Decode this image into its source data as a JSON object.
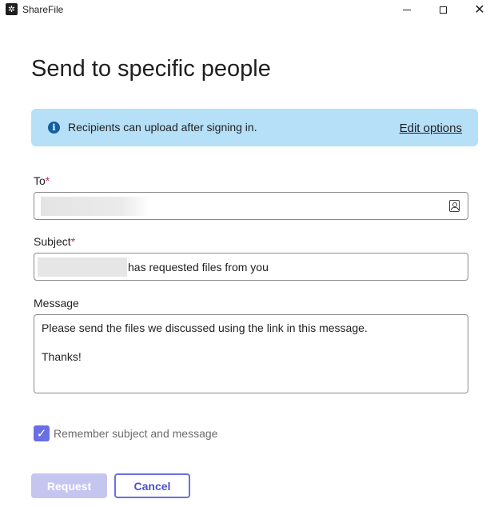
{
  "window": {
    "title": "ShareFile",
    "app_icon": "sharefile-logo-icon",
    "controls": [
      "minimize-icon",
      "maximize-icon",
      "close-icon"
    ]
  },
  "page": {
    "title": "Send to specific people"
  },
  "banner": {
    "icon": "info-icon",
    "text": "Recipients can upload after signing in.",
    "link": "Edit options",
    "color": "#b6dff8"
  },
  "form": {
    "to": {
      "label": "To",
      "required_mark": "*",
      "value_redacted": true,
      "contacts_icon": "address-book-icon"
    },
    "subject": {
      "label": "Subject",
      "required_mark": "*",
      "value_suffix": "has requested files from you",
      "prefix_redacted": true
    },
    "message": {
      "label": "Message",
      "lines": [
        "Please send the files we discussed using the link in this message.",
        "Thanks!"
      ]
    },
    "remember": {
      "label": "Remember subject and message",
      "checked": true
    }
  },
  "actions": {
    "request_label": "Request",
    "request_enabled": false,
    "cancel_label": "Cancel",
    "accent_color": "#6a6fe3"
  }
}
